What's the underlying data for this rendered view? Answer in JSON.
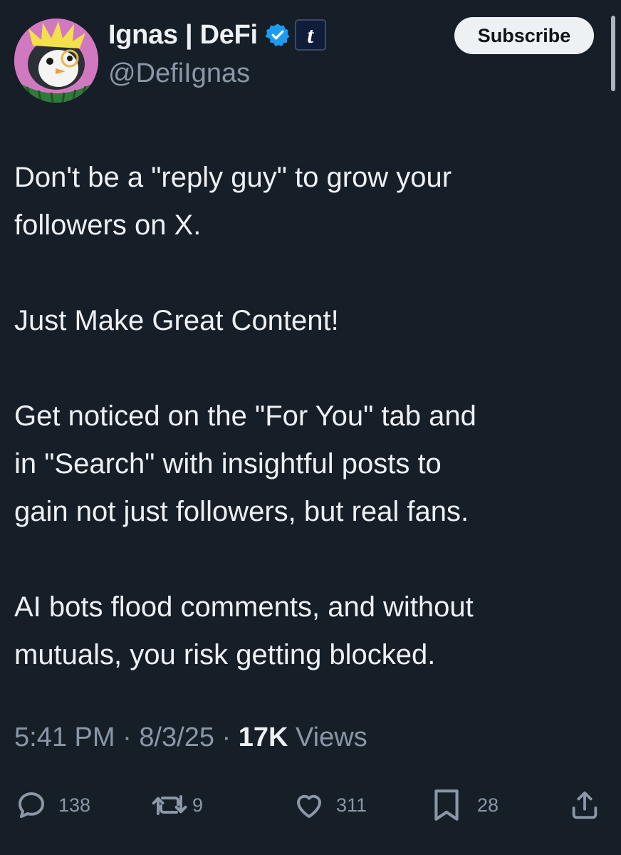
{
  "author": {
    "display_name": "Ignas | DeFi",
    "handle": "@DefiIgnas",
    "affiliate_badge_letter": "t",
    "verified_color": "#1d9bf0",
    "avatar_icon": "penguin-avatar"
  },
  "header": {
    "subscribe_label": "Subscribe"
  },
  "post": {
    "paragraphs": [
      "Don't be a \"reply guy\" to grow your\nfollowers on X.",
      "Just Make Great Content!",
      "Get noticed on the \"For You\" tab and\nin \"Search\" with insightful posts to\ngain not just followers, but real fans.",
      "AI bots flood comments, and without\nmutuals, you risk getting blocked."
    ]
  },
  "meta": {
    "time": "5:41 PM",
    "separator": " · ",
    "date": "8/3/25",
    "views_count": "17K",
    "views_label": " Views"
  },
  "actions": {
    "replies": "138",
    "reposts": "9",
    "likes": "311",
    "bookmarks": "28",
    "icons": [
      "reply-icon",
      "repost-icon",
      "like-icon",
      "bookmark-icon",
      "share-icon"
    ]
  },
  "colors": {
    "background": "#161e28",
    "text": "#eef1f4",
    "muted": "#8a97a6"
  }
}
